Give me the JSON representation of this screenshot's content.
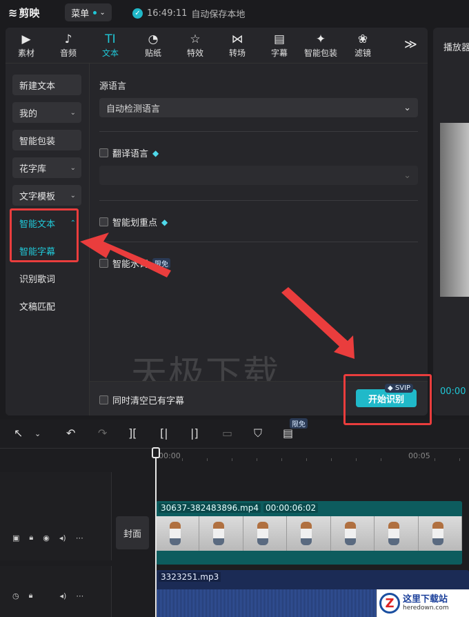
{
  "app": {
    "name": "剪映",
    "menu_label": "菜单",
    "save_time": "16:49:11",
    "save_text": "自动保存本地"
  },
  "toolbar": {
    "tabs": [
      {
        "label": "素材",
        "icon": "media-icon",
        "glyph": "▶"
      },
      {
        "label": "音频",
        "icon": "audio-icon",
        "glyph": "♪"
      },
      {
        "label": "文本",
        "icon": "text-icon",
        "glyph": "TI"
      },
      {
        "label": "贴纸",
        "icon": "sticker-icon",
        "glyph": "◔"
      },
      {
        "label": "特效",
        "icon": "effects-icon",
        "glyph": "☆"
      },
      {
        "label": "转场",
        "icon": "transition-icon",
        "glyph": "⋈"
      },
      {
        "label": "字幕",
        "icon": "subtitle-icon",
        "glyph": "▤"
      },
      {
        "label": "智能包装",
        "icon": "smart-pack-icon",
        "glyph": "✦"
      },
      {
        "label": "滤镜",
        "icon": "filter-icon",
        "glyph": "❀"
      }
    ],
    "active_tab": "文本",
    "more": "≫"
  },
  "sidebar": {
    "items": [
      {
        "label": "新建文本",
        "chevron": ""
      },
      {
        "label": "我的",
        "chevron": "⌄"
      },
      {
        "label": "智能包装",
        "chevron": ""
      },
      {
        "label": "花字库",
        "chevron": "⌄"
      },
      {
        "label": "文字模板",
        "chevron": "⌄"
      },
      {
        "label": "智能文本",
        "chevron": "⌃"
      },
      {
        "label": "智能字幕",
        "chevron": ""
      },
      {
        "label": "识别歌词",
        "chevron": ""
      },
      {
        "label": "文稿匹配",
        "chevron": ""
      }
    ]
  },
  "panel": {
    "source_language_label": "源语言",
    "source_language_value": "自动检测语言",
    "translate_label": "翻译语言",
    "highlight_label": "智能划重点",
    "filler_label": "智能",
    "filler_label_tail": "水词",
    "limited_free": "限免",
    "watermark": "天极下载",
    "clear_label": "同时清空已有字幕",
    "start_button": "开始识别",
    "svip_badge": "SVIP"
  },
  "player": {
    "title": "播放器",
    "time": "00:00"
  },
  "timeline": {
    "limited_free": "限免",
    "ruler": [
      "00:00",
      "00:05"
    ],
    "cover_label": "封面",
    "video_clip": {
      "name": "30637-382483896.mp4",
      "duration": "00:00:06:02"
    },
    "audio_clip": {
      "name": "3323251.mp3"
    }
  },
  "site_logo": {
    "title": "这里下载站",
    "domain": "heredown.com",
    "letter": "Z"
  },
  "colors": {
    "accent": "#20c8d8",
    "annotation": "#ea3d3d",
    "background": "#1b1b1e"
  }
}
